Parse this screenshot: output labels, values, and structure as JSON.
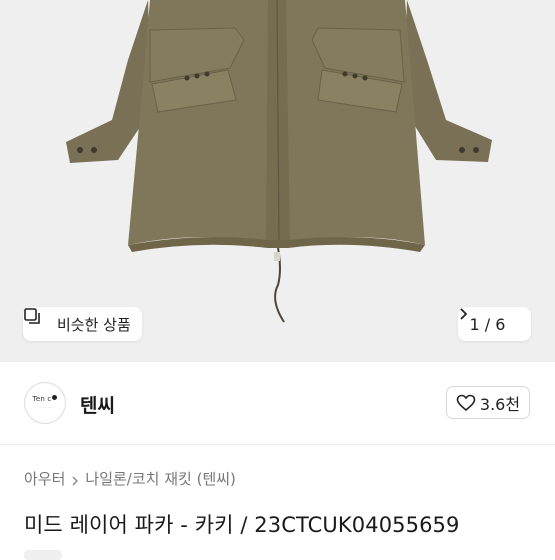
{
  "gallery": {
    "similar_label": "비슷한 상품",
    "counter": "1 / 6",
    "background_color": "#efefef",
    "jacket_color": "#7d7358"
  },
  "shop": {
    "logo_text": "Ten c",
    "name": "텐씨",
    "likes": "3.6천"
  },
  "breadcrumb": [
    "아우터",
    "나일론/코치 재킷 (텐씨)"
  ],
  "product": {
    "title": "미드 레이어 파카 - 카키 / 23CTCUK04055659"
  }
}
